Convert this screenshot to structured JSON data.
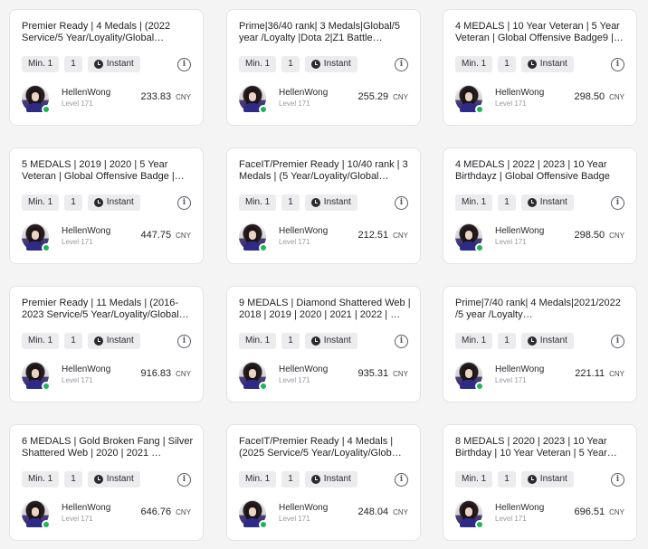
{
  "listings": [
    {
      "title": "Premier Ready | 4 Medals | (2022 Service/5 Year/Loyality/Global…",
      "min": "Min. 1",
      "qty": "1",
      "delivery": "Instant",
      "seller": "HellenWong",
      "level": "Level 171",
      "price": "233.83",
      "currency": "CNY"
    },
    {
      "title": "Prime|36/40 rank| 3 Medals|Global/5 year /Loyalty |Dota 2|Z1 Battle…",
      "min": "Min. 1",
      "qty": "1",
      "delivery": "Instant",
      "seller": "HellenWong",
      "level": "Level 171",
      "price": "255.29",
      "currency": "CNY"
    },
    {
      "title": "4 MEDALS | 10 Year Veteran | 5 Year Veteran | Global Offensive Badge9 |…",
      "min": "Min. 1",
      "qty": "1",
      "delivery": "Instant",
      "seller": "HellenWong",
      "level": "Level 171",
      "price": "298.50",
      "currency": "CNY"
    },
    {
      "title": "5 MEDALS | 2019 | 2020 | 5 Year Veteran | Global Offensive Badge |…",
      "min": "Min. 1",
      "qty": "1",
      "delivery": "Instant",
      "seller": "HellenWong",
      "level": "Level 171",
      "price": "447.75",
      "currency": "CNY"
    },
    {
      "title": "FaceIT/Premier Ready | 10/40 rank | 3 Medals | (5 Year/Loyality/Global…",
      "min": "Min. 1",
      "qty": "1",
      "delivery": "Instant",
      "seller": "HellenWong",
      "level": "Level 171",
      "price": "212.51",
      "currency": "CNY"
    },
    {
      "title": "4 MEDALS | 2022 | 2023 | 10 Year Birthdayz | Global Offensive Badge",
      "min": "Min. 1",
      "qty": "1",
      "delivery": "Instant",
      "seller": "HellenWong",
      "level": "Level 171",
      "price": "298.50",
      "currency": "CNY"
    },
    {
      "title": "Premier Ready | 11 Medals | (2016-2023 Service/5 Year/Loyality/Global…",
      "min": "Min. 1",
      "qty": "1",
      "delivery": "Instant",
      "seller": "HellenWong",
      "level": "Level 171",
      "price": "916.83",
      "currency": "CNY"
    },
    {
      "title": "9 MEDALS | Diamond Shattered Web | 2018 | 2019 | 2020 | 2021 | 2022 | …",
      "min": "Min. 1",
      "qty": "1",
      "delivery": "Instant",
      "seller": "HellenWong",
      "level": "Level 171",
      "price": "935.31",
      "currency": "CNY"
    },
    {
      "title": "Prime|7/40 rank| 4 Medals|2021/2022 /5 year /Loyalty…",
      "min": "Min. 1",
      "qty": "1",
      "delivery": "Instant",
      "seller": "HellenWong",
      "level": "Level 171",
      "price": "221.11",
      "currency": "CNY"
    },
    {
      "title": "6 MEDALS | Gold Broken Fang | Silver Shattered Web | 2020 | 2021 …",
      "min": "Min. 1",
      "qty": "1",
      "delivery": "Instant",
      "seller": "HellenWong",
      "level": "Level 171",
      "price": "646.76",
      "currency": "CNY"
    },
    {
      "title": "FaceIT/Premier Ready | 4 Medals | (2025 Service/5 Year/Loyality/Glob…",
      "min": "Min. 1",
      "qty": "1",
      "delivery": "Instant",
      "seller": "HellenWong",
      "level": "Level 171",
      "price": "248.04",
      "currency": "CNY"
    },
    {
      "title": "8 MEDALS | 2020 | 2023 | 10 Year Birthday | 10 Year Veteran | 5 Year…",
      "min": "Min. 1",
      "qty": "1",
      "delivery": "Instant",
      "seller": "HellenWong",
      "level": "Level 171",
      "price": "696.51",
      "currency": "CNY"
    }
  ],
  "icons": {
    "delivery": "clock-icon",
    "info": "info-icon",
    "status": "online-status-dot"
  },
  "colors": {
    "card_bg": "#ffffff",
    "page_bg": "#f4f4f5",
    "chip_bg": "#ececef",
    "online": "#1fb35b"
  }
}
